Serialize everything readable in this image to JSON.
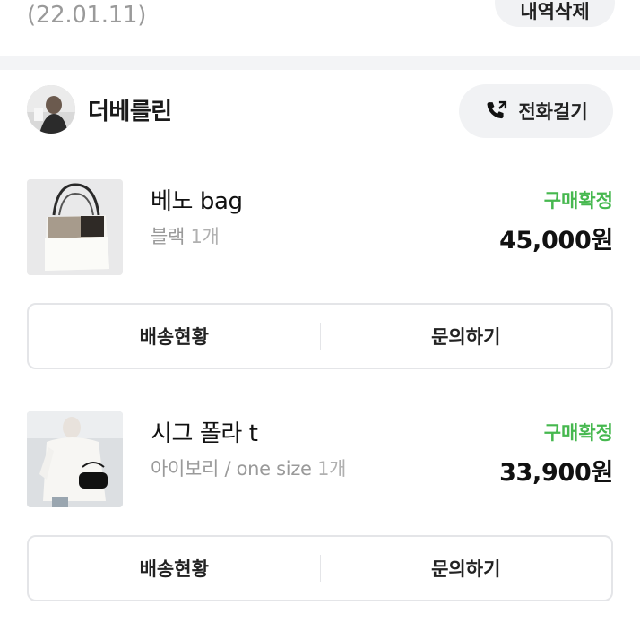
{
  "previous_order": {
    "date": "(22.01.11)",
    "delete_label": "내역삭제"
  },
  "shop": {
    "name": "더베를린",
    "call_label": "전화걸기"
  },
  "orders": [
    {
      "product_name": "베노 bag",
      "option": "블랙",
      "quantity": "1개",
      "status": "구매확정",
      "price": "45,000원",
      "actions": {
        "shipping": "배송현황",
        "inquiry": "문의하기"
      }
    },
    {
      "product_name": "시그 폴라 t",
      "option": "아이보리 / one size",
      "quantity": "1개",
      "status": "구매확정",
      "price": "33,900원",
      "actions": {
        "shipping": "배송현황",
        "inquiry": "문의하기"
      }
    }
  ],
  "colors": {
    "status_green": "#46b84f",
    "button_bg": "#f1f2f4",
    "border": "#e4e5e8",
    "muted_text": "#9a9a9a"
  },
  "icons": {
    "call": "phone-call-icon"
  }
}
